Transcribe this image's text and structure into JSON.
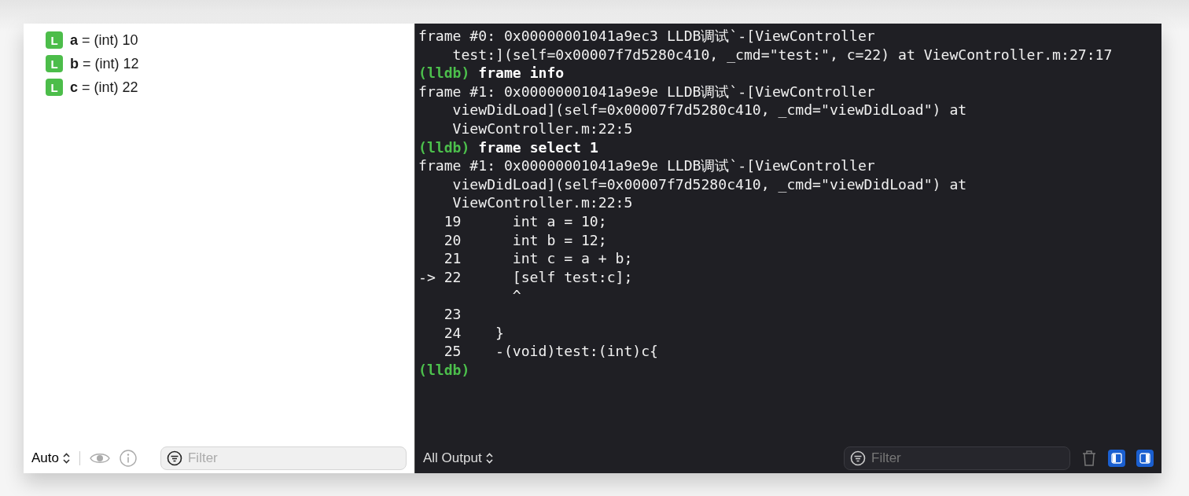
{
  "variables": [
    {
      "text": "**a** = (int) 10",
      "icon": "L"
    },
    {
      "text": "**b** = (int) 12",
      "icon": "L"
    },
    {
      "text": "**c** = (int) 22",
      "icon": "L"
    }
  ],
  "variables_bar": {
    "scope": "Auto",
    "filter": {
      "placeholder": "Filter"
    }
  },
  "console": {
    "lines": [
      {
        "kind": "output",
        "text": "frame #0: 0x00000001041a9ec3 LLDB调试`-[ViewController"
      },
      {
        "kind": "output",
        "text": "    test:](self=0x00007f7d5280c410, _cmd=\"test:\", c=22) at ViewController.m:27:17"
      },
      {
        "kind": "prompt",
        "prompt": "(lldb)",
        "command": "frame info"
      },
      {
        "kind": "output",
        "text": "frame #1: 0x00000001041a9e9e LLDB调试`-[ViewController"
      },
      {
        "kind": "output",
        "text": "    viewDidLoad](self=0x00007f7d5280c410, _cmd=\"viewDidLoad\") at"
      },
      {
        "kind": "output",
        "text": "    ViewController.m:22:5"
      },
      {
        "kind": "prompt",
        "prompt": "(lldb)",
        "command": "frame select 1"
      },
      {
        "kind": "output",
        "text": "frame #1: 0x00000001041a9e9e LLDB调试`-[ViewController"
      },
      {
        "kind": "output",
        "text": "    viewDidLoad](self=0x00007f7d5280c410, _cmd=\"viewDidLoad\") at"
      },
      {
        "kind": "output",
        "text": "    ViewController.m:22:5"
      },
      {
        "kind": "output",
        "text": "   19      int a = 10;"
      },
      {
        "kind": "output",
        "text": "   20      int b = 12;"
      },
      {
        "kind": "output",
        "text": "   21      int c = a + b;"
      },
      {
        "kind": "output",
        "text": "-> 22      [self test:c];"
      },
      {
        "kind": "output",
        "text": "           ^"
      },
      {
        "kind": "output",
        "text": "   23"
      },
      {
        "kind": "output",
        "text": "   24    }"
      },
      {
        "kind": "output",
        "text": "   25    -(void)test:(int)c{"
      },
      {
        "kind": "prompt",
        "prompt": "(lldb)"
      }
    ],
    "output_menu": "All Output",
    "filter": {
      "placeholder": "Filter"
    }
  }
}
